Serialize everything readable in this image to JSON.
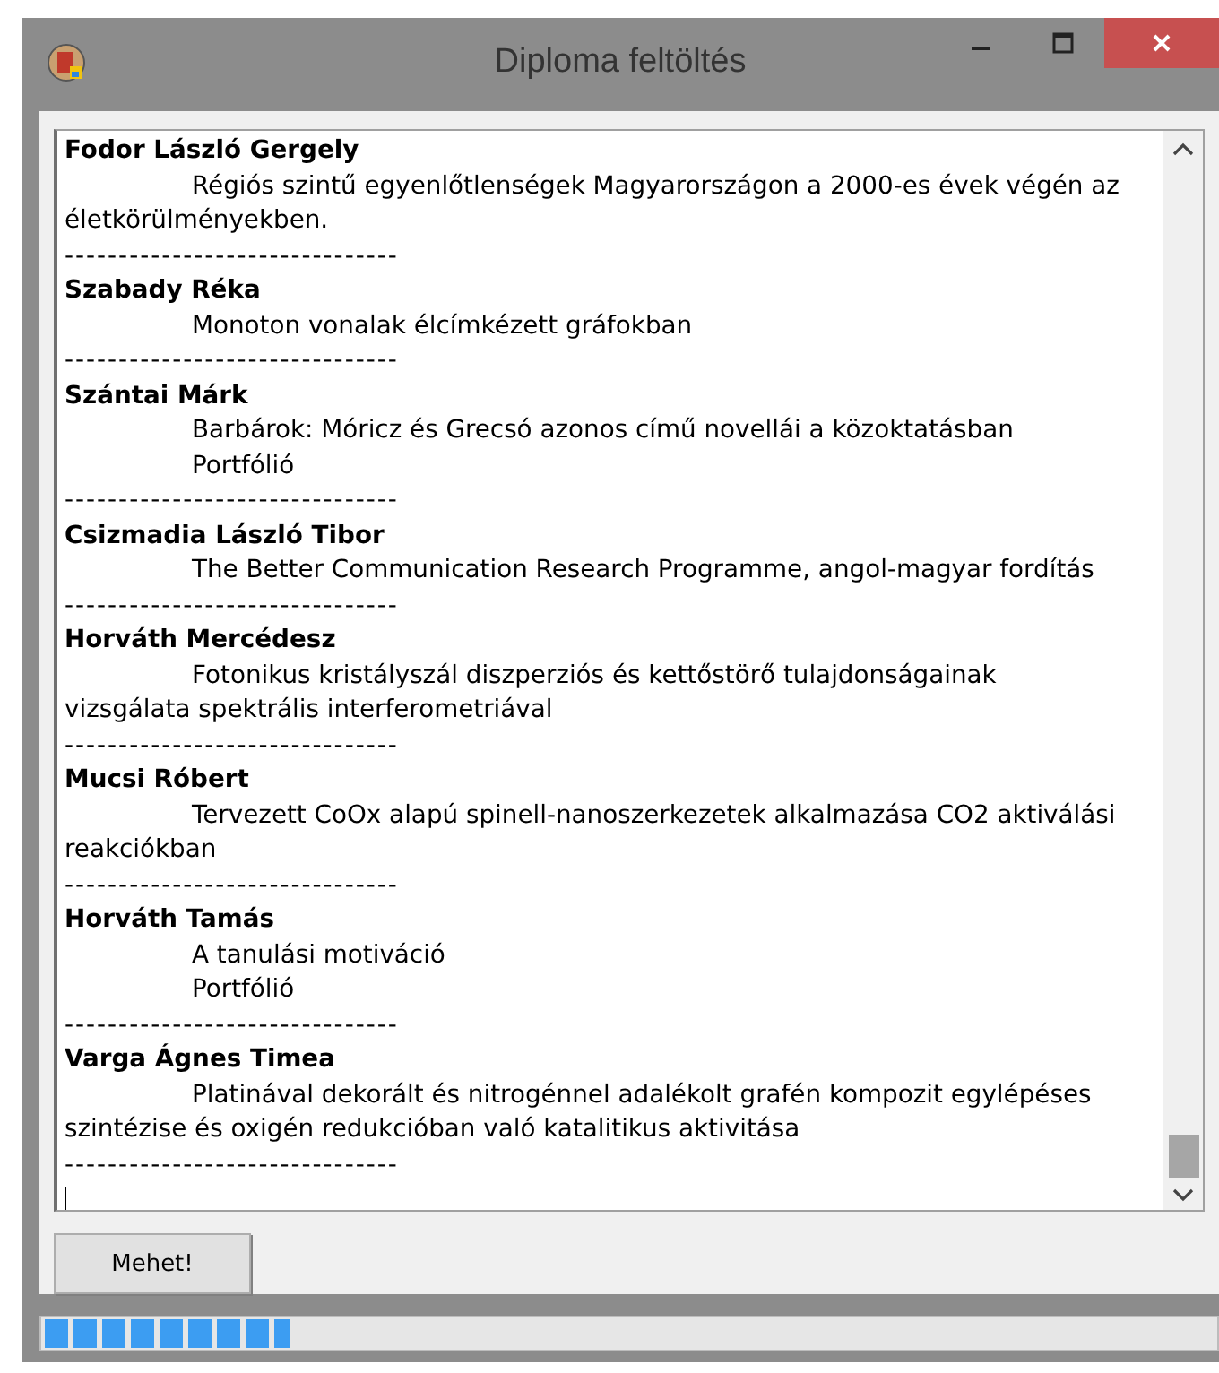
{
  "window": {
    "title": "Diploma feltöltés"
  },
  "entries": [
    {
      "name": "Fodor László Gergely",
      "paragraphs": [
        "Régiós szintű egyenlőtlenségek Magyarországon a 2000-es évek végén az életkörülményekben."
      ],
      "separator": "-------------------------------"
    },
    {
      "name": "Szabady Réka",
      "paragraphs": [
        "Monoton vonalak élcímkézett gráfokban"
      ],
      "separator": "-------------------------------"
    },
    {
      "name": "Szántai Márk",
      "paragraphs": [
        "Barbárok: Móricz és Grecsó azonos című novellái a közoktatásban",
        "Portfólió"
      ],
      "separator": "-------------------------------"
    },
    {
      "name": "Csizmadia László Tibor",
      "paragraphs": [
        "The Better Communication Research Programme, angol-magyar fordítás"
      ],
      "separator": "-------------------------------"
    },
    {
      "name": "Horváth Mercédesz",
      "paragraphs": [
        "Fotonikus kristályszál diszperziós és kettőstörő tulajdonságainak vizsgálata spektrális interferometriával"
      ],
      "separator": "-------------------------------"
    },
    {
      "name": "Mucsi Róbert",
      "paragraphs": [
        "Tervezett CoOx alapú spinell-nanoszerkezetek alkalmazása CO2 aktiválási reakciókban"
      ],
      "separator": "-------------------------------"
    },
    {
      "name": "Horváth Tamás",
      "paragraphs": [
        "A tanulási motiváció",
        "Portfólió"
      ],
      "separator": "-------------------------------"
    },
    {
      "name": "Varga Ágnes Timea",
      "paragraphs": [
        "Platinával dekorált és nitrogénnel adalékolt grafén kompozit egylépéses szintézise és oxigén redukcióban való katalitikus aktivitása"
      ],
      "separator": "-------------------------------"
    }
  ],
  "button": {
    "label": "Mehet!"
  },
  "progress": {
    "level": 0.21
  }
}
